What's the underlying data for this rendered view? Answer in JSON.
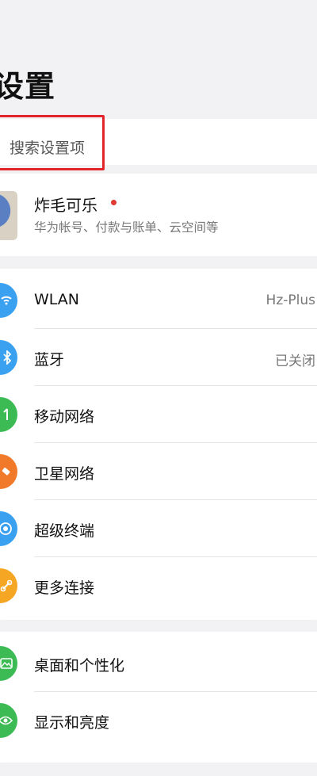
{
  "header": {
    "title": "设置"
  },
  "search": {
    "placeholder": "搜索设置项"
  },
  "account": {
    "name": "炸毛可乐",
    "subtitle": "华为帐号、付款与账单、云空间等",
    "has_notification": true
  },
  "connections": [
    {
      "label": "WLAN",
      "value": "Hz-Plus",
      "icon": "wifi-icon",
      "color": "#3aa0f0"
    },
    {
      "label": "蓝牙",
      "value": "已关闭",
      "icon": "bluetooth-icon",
      "color": "#3aa0f0"
    },
    {
      "label": "移动网络",
      "value": "",
      "icon": "mobile-network-icon",
      "color": "#3cba54"
    },
    {
      "label": "卫星网络",
      "value": "",
      "icon": "satellite-icon",
      "color": "#f07a2a"
    },
    {
      "label": "超级终端",
      "value": "",
      "icon": "super-device-icon",
      "color": "#3aa0f0"
    },
    {
      "label": "更多连接",
      "value": "",
      "icon": "link-icon",
      "color": "#f5a623"
    }
  ],
  "display": [
    {
      "label": "桌面和个性化",
      "icon": "wallpaper-icon",
      "color": "#3cba54"
    },
    {
      "label": "显示和亮度",
      "icon": "eye-icon",
      "color": "#3cba54"
    }
  ]
}
